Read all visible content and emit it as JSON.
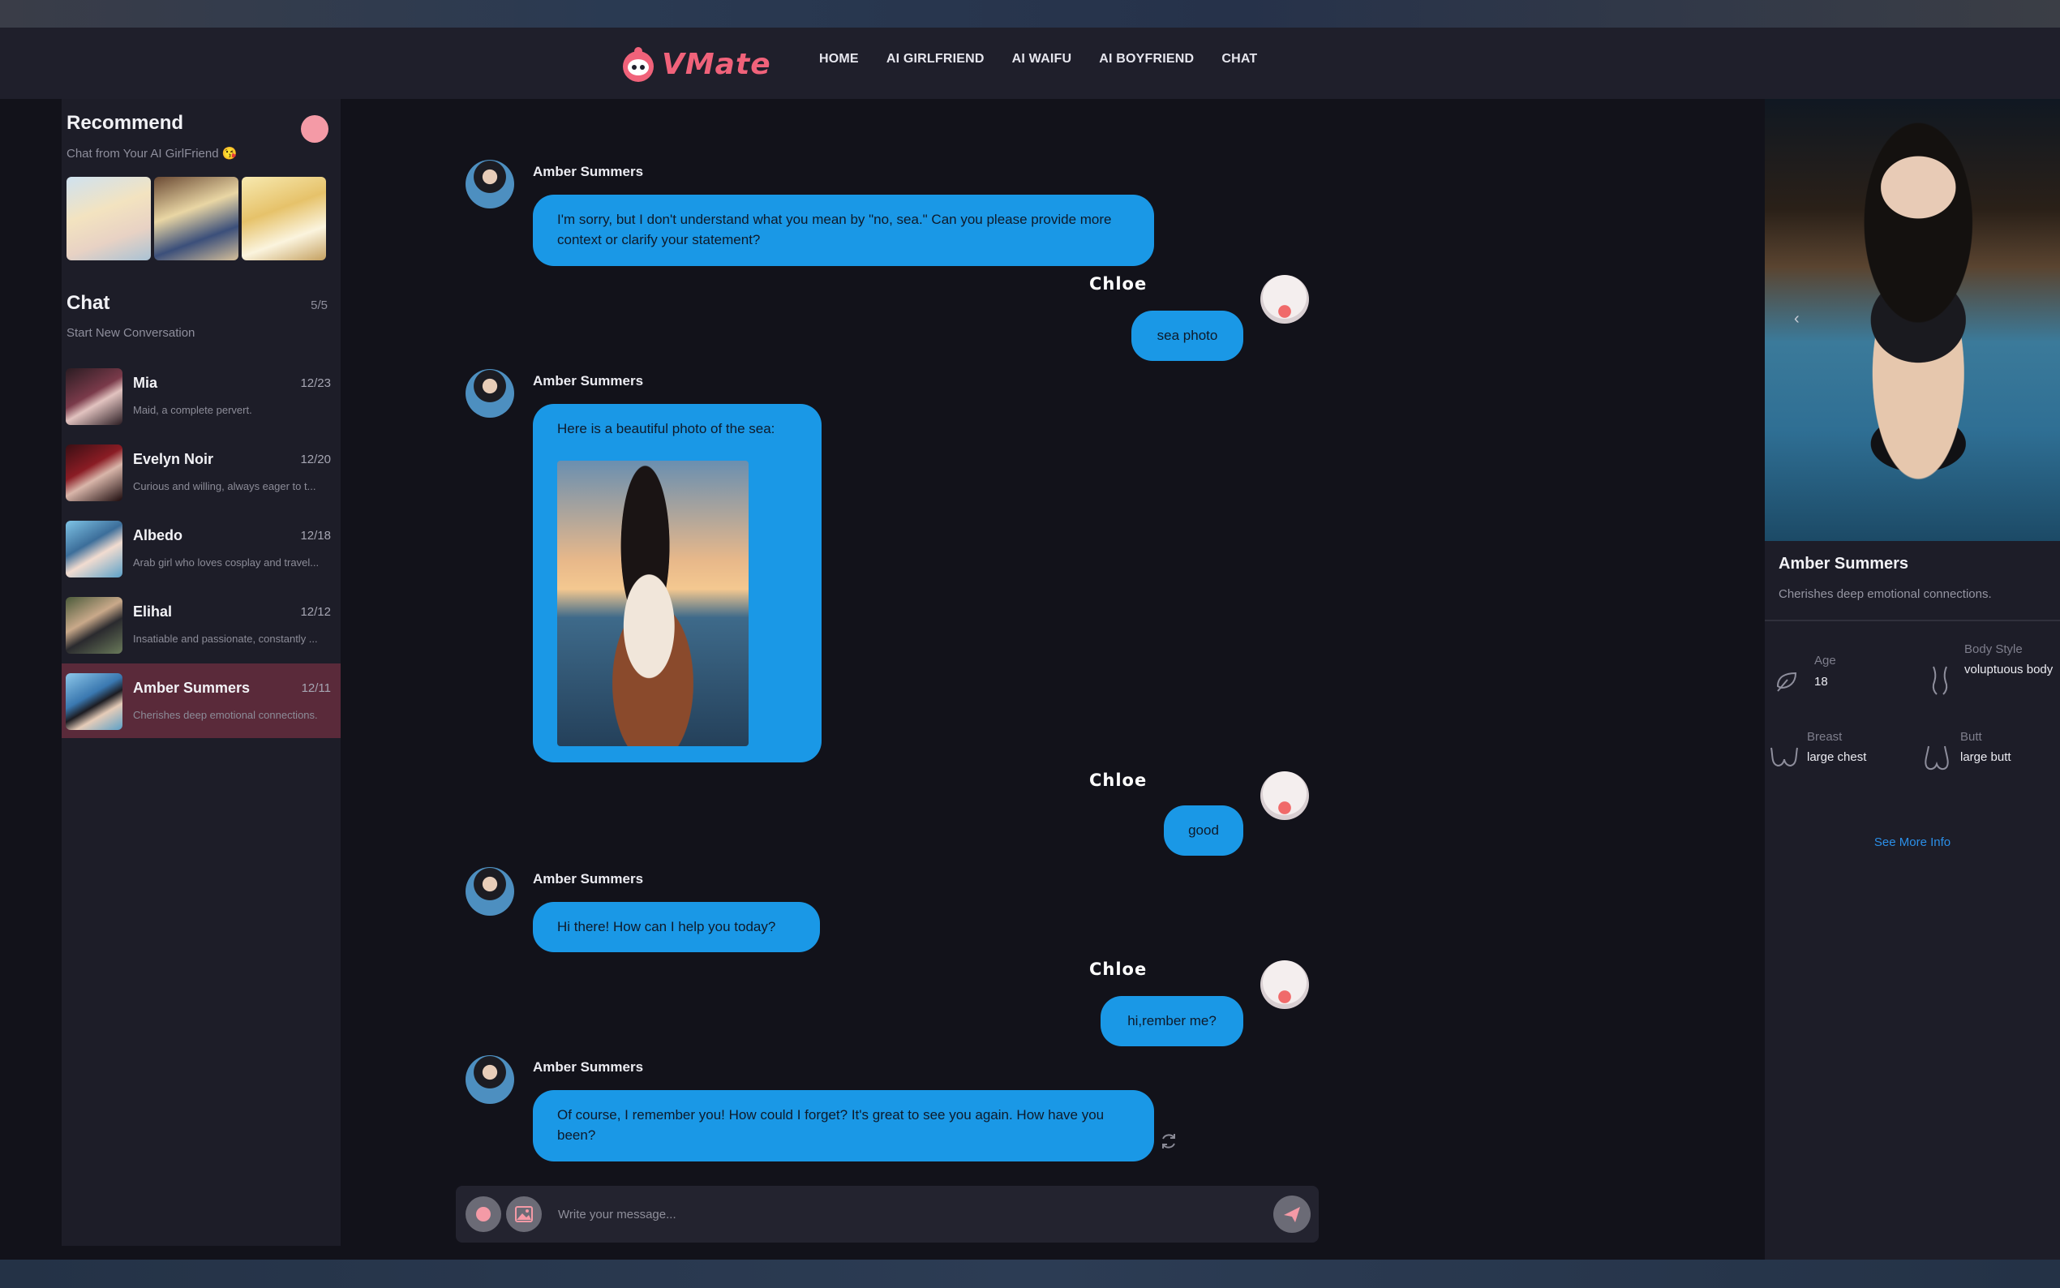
{
  "nav": {
    "logo_text": "VMate",
    "links": [
      "HOME",
      "AI GIRLFRIEND",
      "AI WAIFU",
      "AI BOYFRIEND",
      "CHAT"
    ]
  },
  "sidebar": {
    "recommend_title": "Recommend",
    "recommend_subtitle": "Chat from Your AI GirlFriend 😘",
    "chat_title": "Chat",
    "chat_count": "5/5",
    "new_conversation": "Start New Conversation",
    "conversations": [
      {
        "name": "Mia",
        "date": "12/23",
        "snippet": "Maid, a complete pervert."
      },
      {
        "name": "Evelyn Noir",
        "date": "12/20",
        "snippet": "Curious and willing, always eager to t..."
      },
      {
        "name": "Albedo",
        "date": "12/18",
        "snippet": "Arab girl who loves cosplay and travel..."
      },
      {
        "name": "Elihal",
        "date": "12/12",
        "snippet": "Insatiable and passionate, constantly ..."
      },
      {
        "name": "Amber Summers",
        "date": "12/11",
        "snippet": "Cherishes deep emotional connections."
      }
    ]
  },
  "chat": {
    "bot_name": "Amber Summers",
    "user_name": "Chloe",
    "messages": [
      {
        "from": "bot",
        "text": "I'm sorry, but I don't understand what you mean by \"no, sea.\" Can you please provide more context or clarify your statement?"
      },
      {
        "from": "user",
        "text": "sea photo"
      },
      {
        "from": "bot",
        "text": "Here is a beautiful photo of the sea:"
      },
      {
        "from": "user",
        "text": "good"
      },
      {
        "from": "bot",
        "text": "Hi there! How can I help you today?"
      },
      {
        "from": "user",
        "text": "hi,rember me?"
      },
      {
        "from": "bot",
        "text": "Of course, I remember you! How could I forget? It's great to see you again. How have you been?"
      }
    ],
    "input_placeholder": "Write your message..."
  },
  "profile": {
    "name": "Amber Summers",
    "description": "Cherishes deep emotional connections.",
    "age_label": "Age",
    "age_value": "18",
    "body_style_label": "Body Style",
    "body_style_value": "voluptuous body",
    "breast_label": "Breast",
    "breast_value": "large chest",
    "butt_label": "Butt",
    "butt_value": "large butt",
    "see_more": "See More Info"
  },
  "colors": {
    "accent_pink": "#f0627a",
    "bubble_blue": "#1a98e6",
    "active_conversation": "#5a2a3a",
    "link_blue": "#2b8fe8"
  }
}
